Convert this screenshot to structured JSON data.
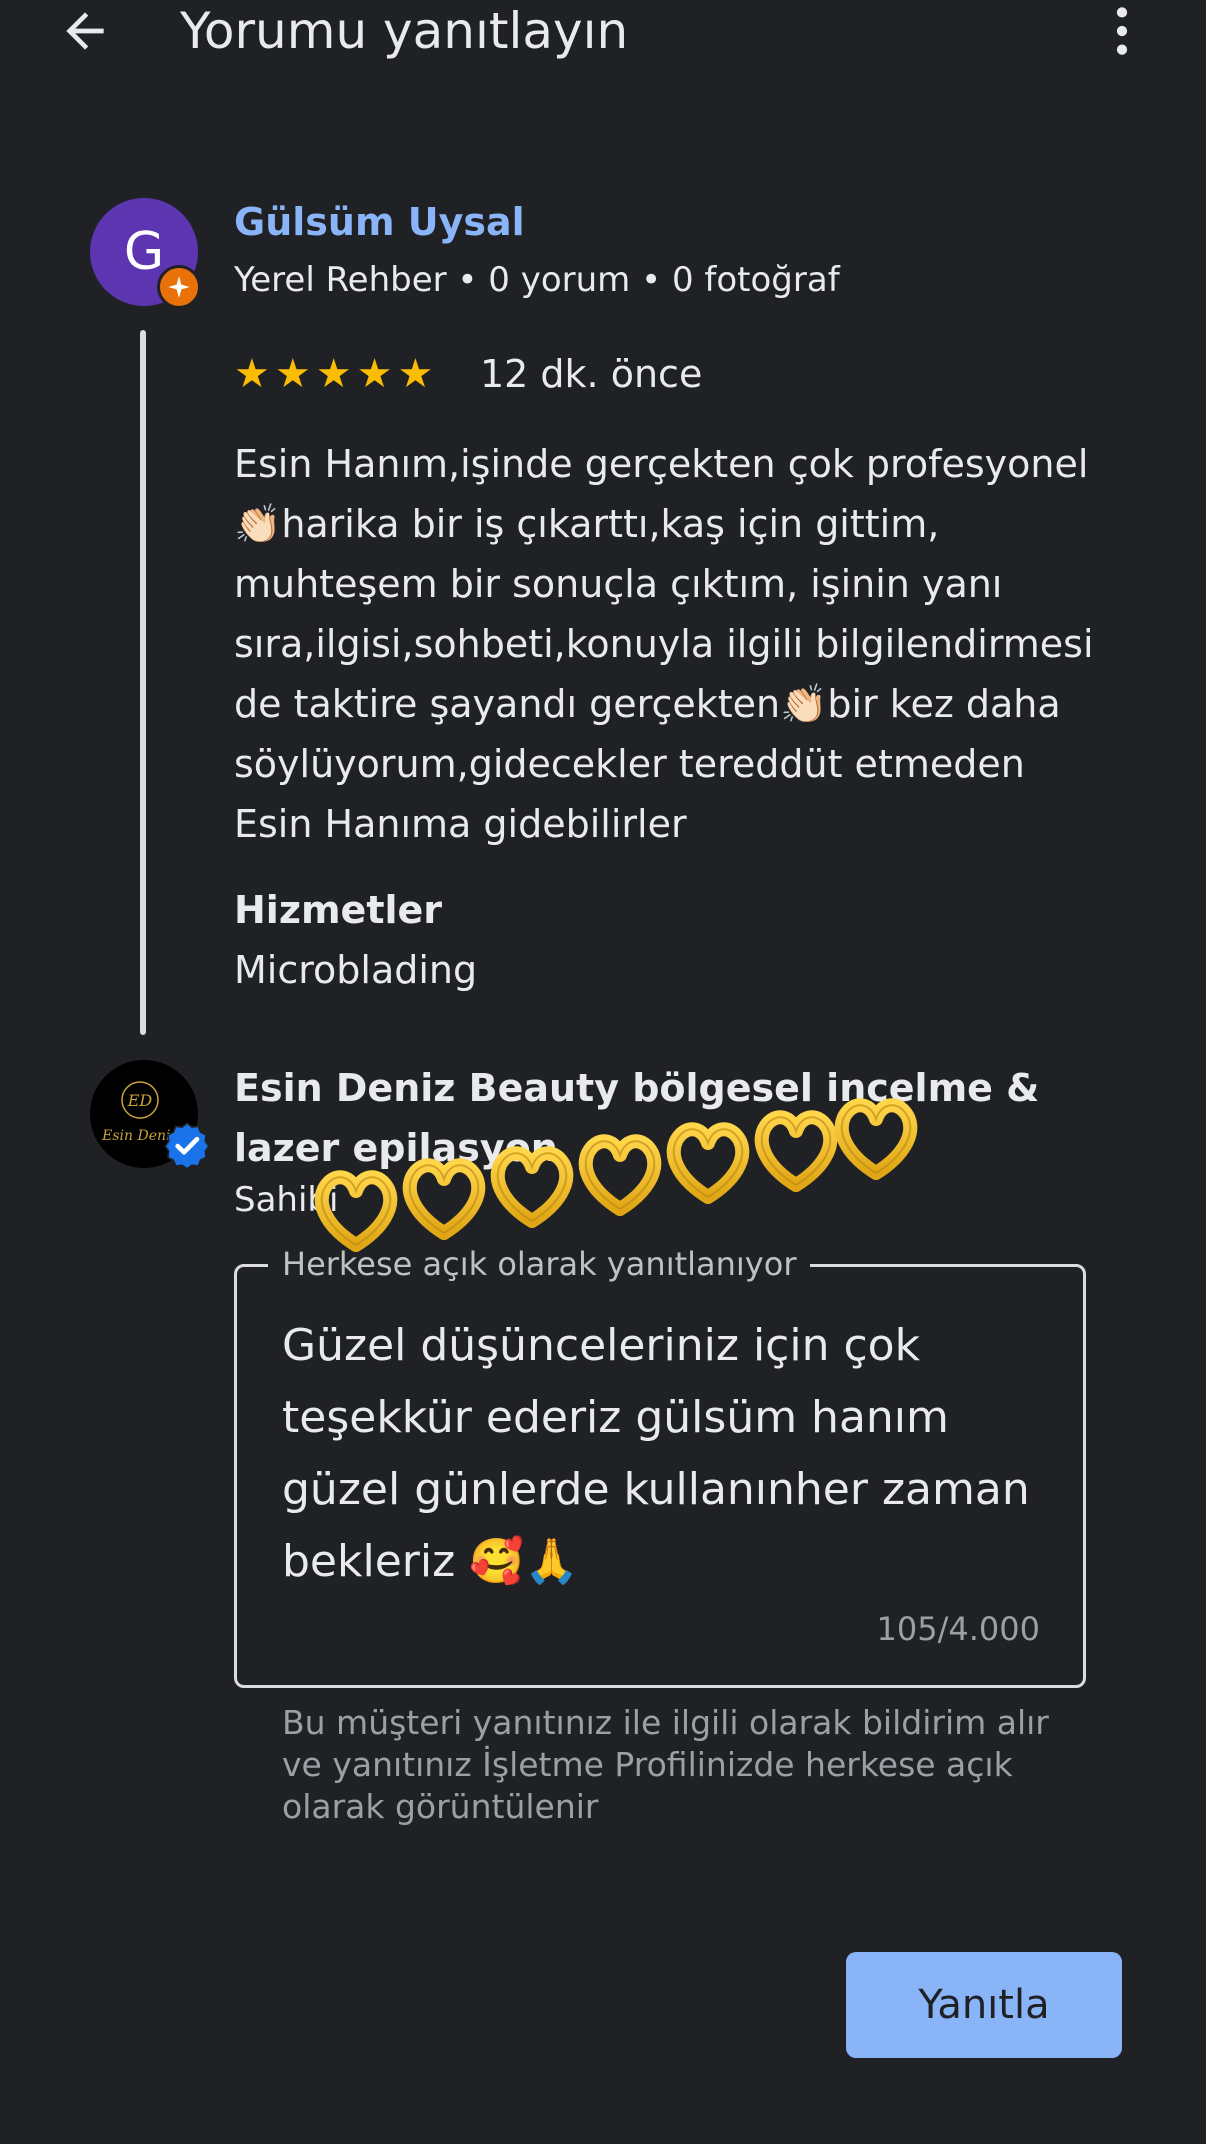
{
  "header": {
    "title": "Yorumu yanıtlayın",
    "back_icon": "arrow-back-icon",
    "menu_icon": "more-vert-icon"
  },
  "review": {
    "avatar_letter": "G",
    "avatar_color": "#5e35b1",
    "reviewer_name": "Gülsüm Uysal",
    "reviewer_meta": "Yerel Rehber • 0 yorum • 0 fotoğraf",
    "rating": 5,
    "time": "12 dk. önce",
    "text": "Esin Hanım,işinde gerçekten çok profesyonel 👏🏻harika bir iş çıkarttı,kaş için gittim, muhteşem bir sonuçla çıktım, işinin yanı sıra,ilgisi,sohbeti,konuyla ilgili bilgilendirmesi de taktire şayandı gerçekten👏🏻bir kez daha söylüyorum,gidecekler tereddüt etmeden Esin Hanıma gidebilirler",
    "services_heading": "Hizmetler",
    "services_value": "Microblading"
  },
  "owner": {
    "name": "Esin Deniz Beauty bölgesel incelme & lazer epilasyon",
    "role": "Sahibi",
    "logo_initials": "ED",
    "logo_script": "Esin Deniz"
  },
  "reply": {
    "label": "Herkese açık olarak yanıtlanıyor",
    "text": "Güzel düşünceleriniz için çok teşekkür ederiz gülsüm hanım güzel günlerde kullanınher zaman bekleriz 🥰🙏",
    "counter": "105/4.000",
    "helper": "Bu müşteri yanıtınız ile ilgili olarak bildirim alır ve yanıtınız İşletme Profilinizde herkese açık olarak görüntülenir"
  },
  "actions": {
    "reply_button": "Yanıtla"
  },
  "colors": {
    "background": "#202124",
    "accent": "#8ab4f8",
    "star": "#fbbc04",
    "guide_badge": "#e8710a",
    "verified": "#1a73e8"
  }
}
